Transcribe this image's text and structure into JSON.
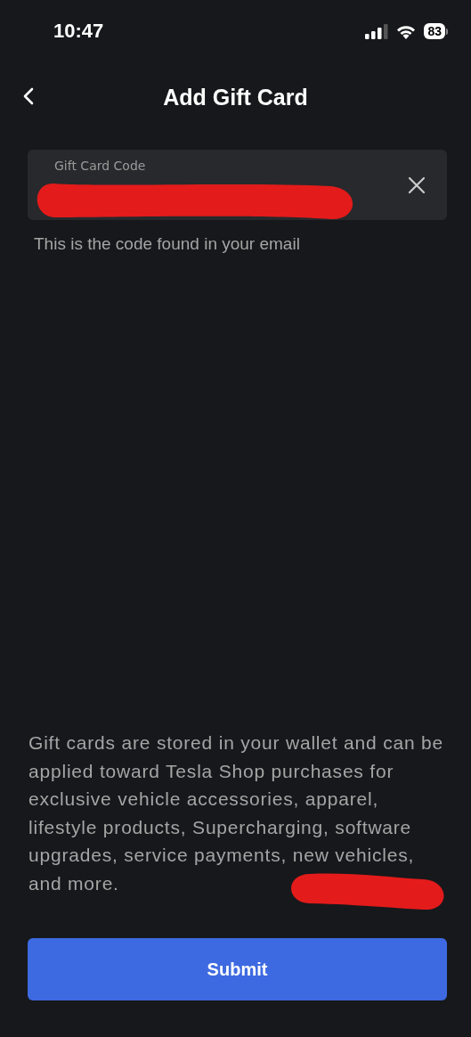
{
  "status_bar": {
    "time": "10:47",
    "battery": "83"
  },
  "header": {
    "title": "Add Gift Card"
  },
  "code_field": {
    "label": "Gift Card Code",
    "redacted": true,
    "helper": "This is the code found in your email"
  },
  "info": {
    "text": "Gift cards are stored in your wallet and can be applied toward Tesla Shop purchases for exclusive vehicle accessories, apparel, lifestyle products, Supercharging, software upgrades, service payments, new vehicles, and more.",
    "redacted": true
  },
  "submit_button": {
    "label": "Submit"
  }
}
